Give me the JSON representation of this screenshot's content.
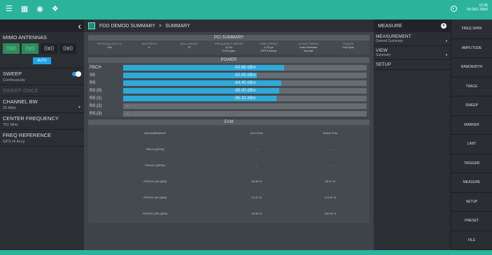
{
  "status": {
    "time": "12:36",
    "date": "00 DEC 0000"
  },
  "left": {
    "mimo_title": "MIMO ANTENNAS",
    "ant_labels": [
      "((φ))",
      "((φ))",
      "((φ))",
      "((φ))"
    ],
    "auto": "AUTO",
    "sweep_title": "SWEEP",
    "sweep_value": "Continuously",
    "sweep_once": "SWEEP ONCE",
    "bw_title": "CHANNEL BW",
    "bw_value": "20 MHz",
    "cf_title": "CENTER FREQUENCY",
    "cf_value": "751 MHz",
    "fr_title": "FREQ REFERENCE",
    "fr_value": "GPS Hi Accy"
  },
  "main": {
    "breadcrumb1": "FDD DEMOD SUMMARY",
    "breadcrumb_sep": ">",
    "breadcrumb2": "SUMMARY",
    "pci_title": "PCI SUMMARY",
    "pci": [
      {
        "h": "PHYSICAL CELL ID",
        "v": "216"
      },
      {
        "h": "SECTOR ID",
        "v": "0"
      },
      {
        "h": "CELL GROUP",
        "v": "72"
      },
      {
        "h": "FREQUENCY ERROR",
        "v": "11 Hz",
        "v2": "0.014 ppm"
      },
      {
        "h": "TIME OFFSET",
        "v": "4.23 μs",
        "v2": "GPS Hi Accy"
      },
      {
        "h": "CYCLIC PREFIX",
        "v": "Auto Detected",
        "v2": "Normal"
      },
      {
        "h": "STATUS",
        "v": "Full Sync"
      }
    ],
    "power_title": "POWER",
    "power": [
      {
        "label": "PBCH",
        "value": "-83.86 dBm",
        "fill": 0.66
      },
      {
        "label": "SS",
        "value": "-92.05 dBm",
        "fill": 0.55
      },
      {
        "label": "RS",
        "value": "-84.40 dBm",
        "fill": 0.65
      },
      {
        "label": "RS (0)",
        "value": "-85.00 dBm",
        "fill": 0.64
      },
      {
        "label": "RS (1)",
        "value": "-85.32 dBm",
        "fill": 0.63
      },
      {
        "label": "RS (2)",
        "value": "--",
        "fill": 0
      },
      {
        "label": "RS (3)",
        "value": "--",
        "fill": 0
      }
    ],
    "evm_title": "EVM",
    "evm_headers": [
      "MEASUREMENT",
      "AVG EVM",
      "PEAK EVM"
    ],
    "evm_rows": [
      [
        "PBCH (QPSK)",
        "--",
        "--"
      ],
      [
        "PDSCH (QPSK)",
        "--",
        "--"
      ],
      [
        "PDSCH (16-QAM)",
        "26.80 %",
        "56.07 %"
      ],
      [
        "PDSCH (64-QAM)",
        "21.57 %",
        "116.42 %"
      ],
      [
        "PDSCH (256-QAM)",
        "15.84 %",
        "291.59 %"
      ]
    ]
  },
  "right": {
    "title": "MEASURE",
    "m_title": "MEASUREMENT",
    "m_value": "Demod Summary",
    "v_title": "VIEW",
    "v_value": "Summary",
    "setup": "SETUP"
  },
  "tabs": [
    "FREQ SPAN",
    "AMPLITUDE",
    "BANDWIDTH",
    "TRACE",
    "SWEEP",
    "MARKER",
    "LIMIT",
    "TRIGGER",
    "MEASURE",
    "SETUP",
    "PRESET",
    "FILE"
  ]
}
